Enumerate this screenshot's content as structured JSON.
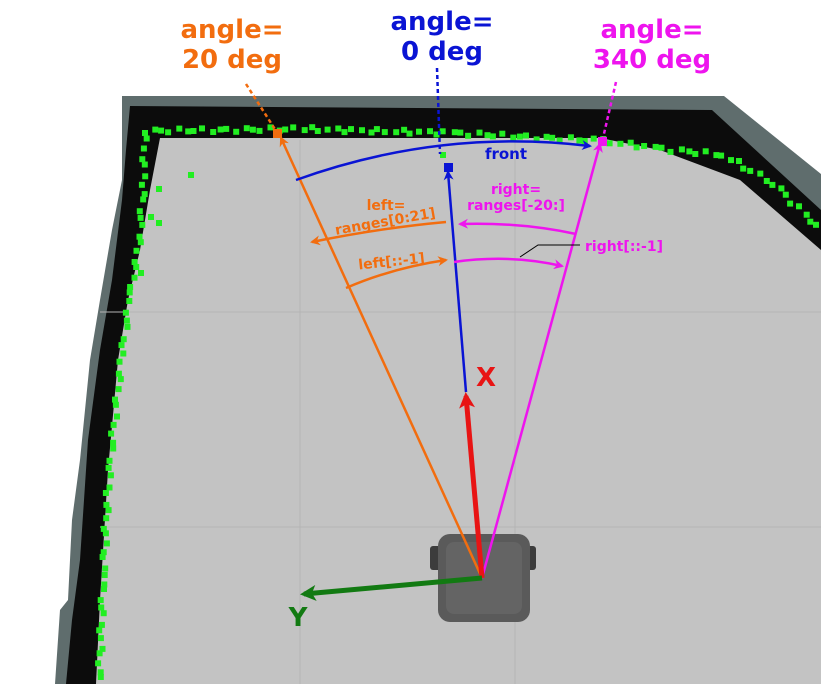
{
  "labels": {
    "angle_left": {
      "line1": "angle=",
      "line2": "20 deg"
    },
    "angle_front": {
      "line1": "angle=",
      "line2": "0 deg"
    },
    "angle_right": {
      "line1": "angle=",
      "line2": "340 deg"
    },
    "front": "front",
    "left_range": {
      "line1": "left=",
      "line2": "ranges[0:21]"
    },
    "left_reverse": "left[::-1]",
    "right_range": {
      "line1": "right=",
      "line2": "ranges[-20:]"
    },
    "right_reverse": "right[::-1]",
    "x_axis": "X",
    "y_axis": "Y"
  },
  "colors": {
    "left": "#f26d0f",
    "front": "#0a14d4",
    "right": "#ee14ee",
    "x_axis": "#e81414",
    "y_axis": "#127a12",
    "scan_points": "#22ee22",
    "free_space": "#c3c3c3",
    "unknown": "#5f6d6d",
    "occupied": "#0c0c0c",
    "robot": "#5a5a5a"
  }
}
